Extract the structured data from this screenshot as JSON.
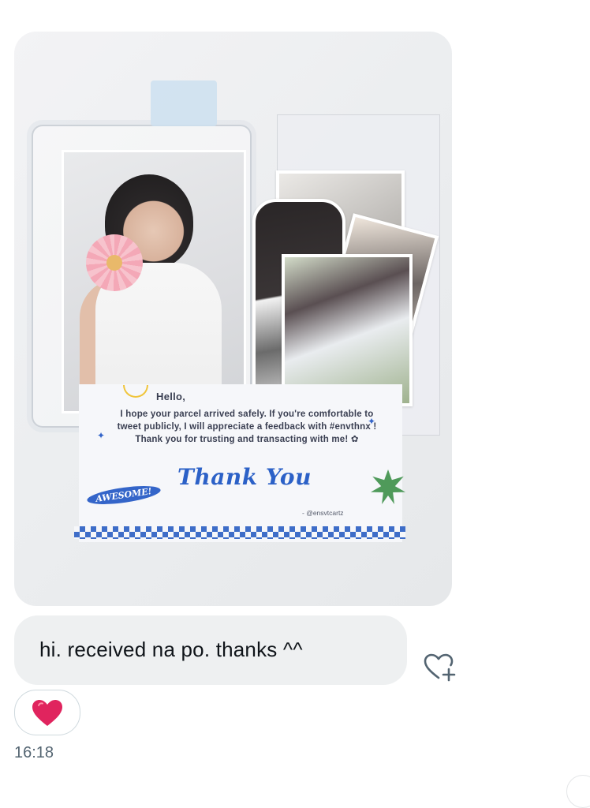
{
  "photo": {
    "card_hello": "Hello,",
    "card_message": "I hope your parcel arrived safely. If you're comfortable to tweet publicly, I will appreciate a feedback with #envthnx ! Thank you for trusting and transacting with me! ✿",
    "card_thank_you": "Thank You",
    "card_badge": "AWESOME!",
    "card_handle": "- @ensvtcartz"
  },
  "message": {
    "text": "hi. received na po. thanks ^^",
    "timestamp": "16:18"
  },
  "reaction": {
    "emoji_name": "red-heart",
    "color": "#e0245e"
  },
  "icons": {
    "add_reaction": "heart-plus-icon"
  }
}
